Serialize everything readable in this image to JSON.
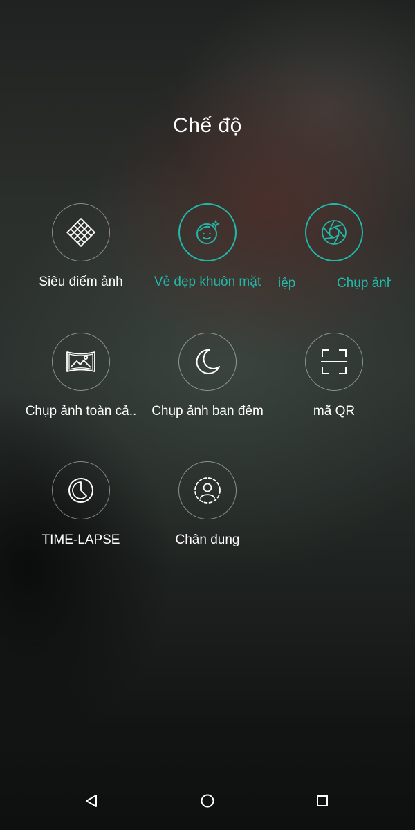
{
  "header": {
    "title": "Chế độ"
  },
  "modes": [
    {
      "label": "Siêu điểm ảnh",
      "icon": "grid-diamond-icon",
      "active": false
    },
    {
      "label": "Vẻ đẹp khuôn mặt",
      "icon": "face-beauty-icon",
      "active": true
    },
    {
      "label": "Chụp ảnh",
      "icon": "aperture-icon",
      "active": true
    },
    {
      "label": "Chụp ảnh toàn cả..",
      "icon": "panorama-icon",
      "active": false
    },
    {
      "label": "Chụp ảnh ban đêm",
      "icon": "moon-icon",
      "active": false
    },
    {
      "label": "mã QR",
      "icon": "qr-scan-icon",
      "active": false
    },
    {
      "label": "TIME-LAPSE",
      "icon": "timelapse-icon",
      "active": false
    },
    {
      "label": "Chân dung",
      "icon": "portrait-icon",
      "active": false
    }
  ],
  "overlap_text": {
    "partial": "iệp"
  },
  "colors": {
    "accent": "#22b8a8",
    "text": "#ffffff"
  },
  "navbar": {
    "back": "back-icon",
    "home": "home-icon",
    "recents": "recents-icon"
  }
}
